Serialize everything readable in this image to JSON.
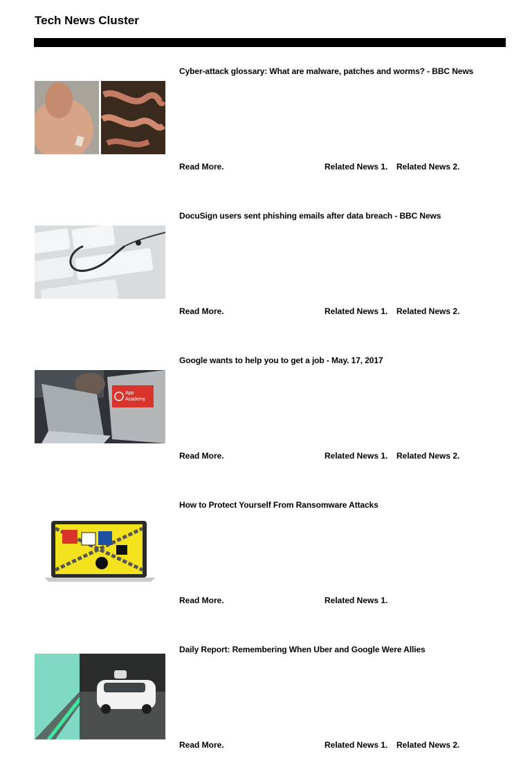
{
  "page": {
    "title": "Tech News Cluster"
  },
  "articles": [
    {
      "headline": "Cyber-attack glossary: What are malware, patches and worms? - BBC News",
      "image": "man-and-worms-photo",
      "read_more": "Read More.",
      "related": [
        "Related News 1.",
        "Related News 2."
      ]
    },
    {
      "headline": "DocuSign users sent phishing emails after data breach - BBC News",
      "image": "keyboard-fishhook-photo",
      "read_more": "Read More.",
      "related": [
        "Related News 1.",
        "Related News 2."
      ]
    },
    {
      "headline": "Google wants to help you to get a job - May. 17, 2017",
      "image": "laptops-app-academy-photo",
      "read_more": "Read More.",
      "related": [
        "Related News 1.",
        "Related News 2."
      ]
    },
    {
      "headline": "How to Protect Yourself From Ransomware Attacks",
      "image": "ransomware-laptop-illustration",
      "read_more": "Read More.",
      "related": [
        "Related News 1."
      ]
    },
    {
      "headline": "Daily Report: Remembering When Uber and Google Were Allies",
      "image": "self-driving-car-photo",
      "read_more": "Read More.",
      "related": [
        "Related News 1.",
        "Related News 2."
      ]
    }
  ],
  "image_text": {
    "app_academy": "App Academy"
  }
}
